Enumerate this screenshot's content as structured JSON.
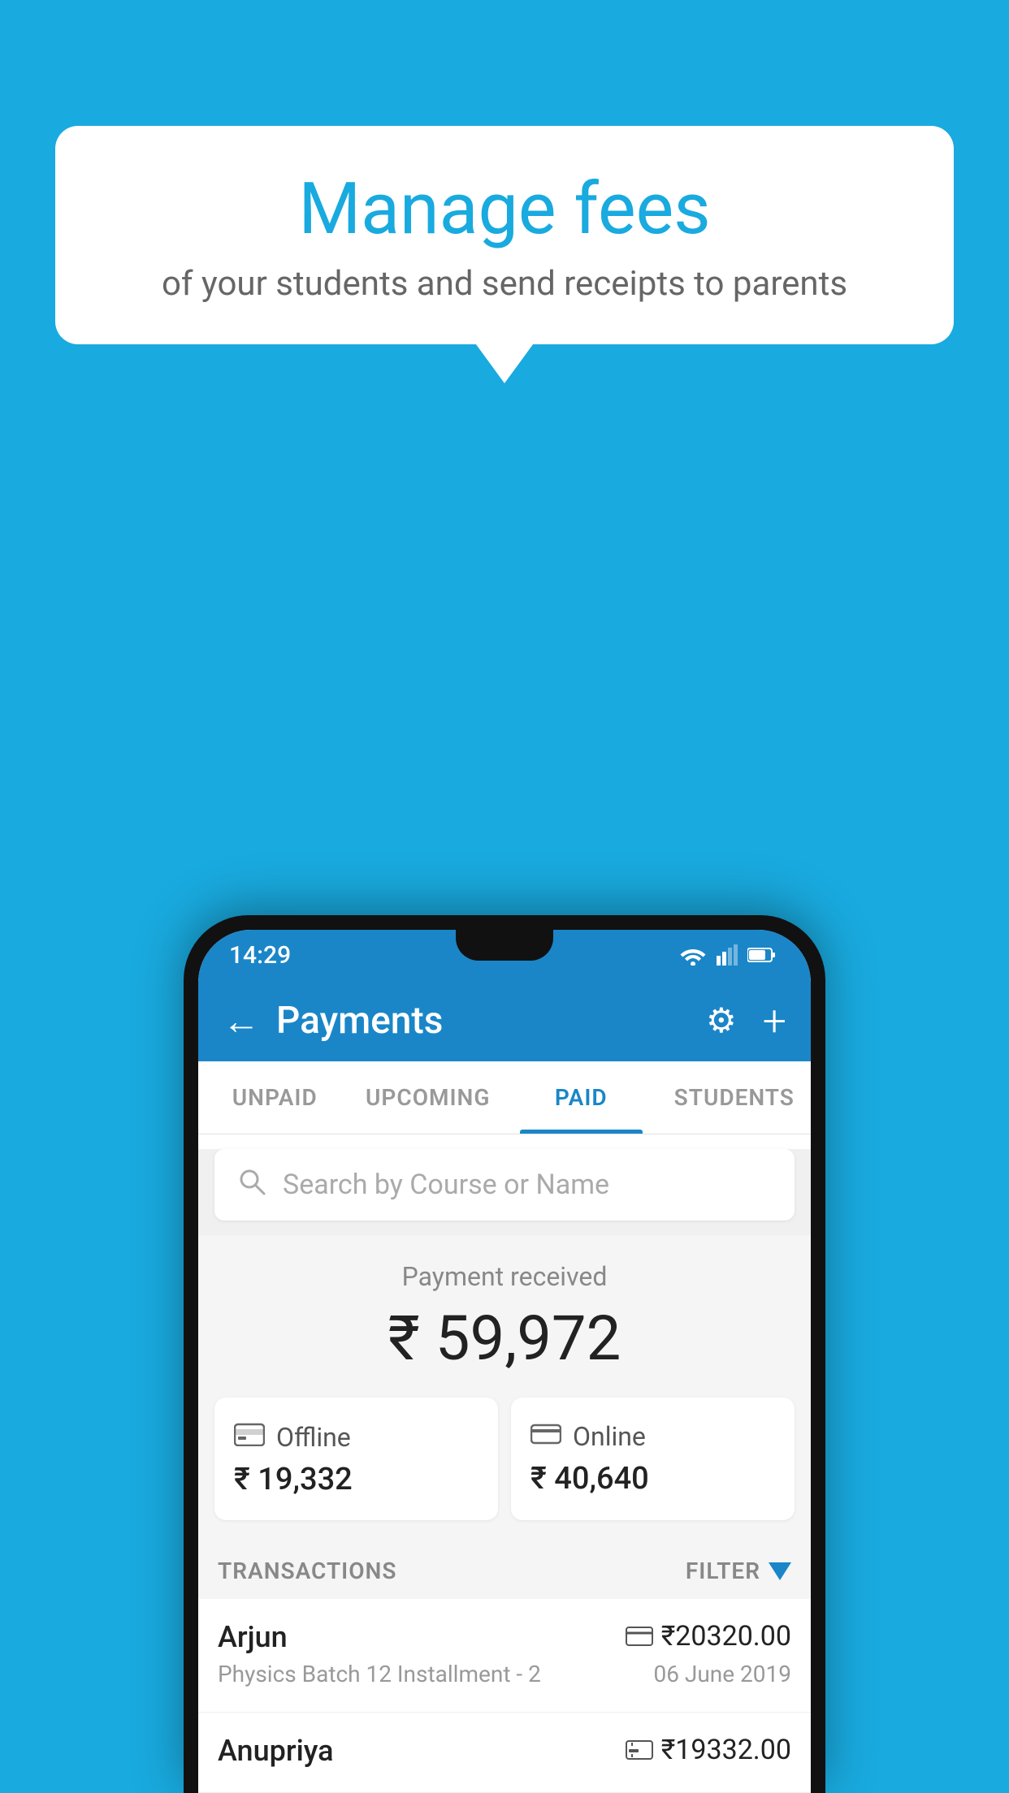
{
  "background": {
    "color": "#19AADF"
  },
  "bubble": {
    "title": "Manage fees",
    "subtitle": "of your students and send receipts to parents"
  },
  "status_bar": {
    "time": "14:29"
  },
  "header": {
    "title": "Payments",
    "back_label": "←",
    "settings_label": "⚙",
    "add_label": "+"
  },
  "tabs": [
    {
      "label": "UNPAID",
      "active": false
    },
    {
      "label": "UPCOMING",
      "active": false
    },
    {
      "label": "PAID",
      "active": true
    },
    {
      "label": "STUDENTS",
      "active": false
    }
  ],
  "search": {
    "placeholder": "Search by Course or Name"
  },
  "payment_received": {
    "label": "Payment received",
    "amount": "₹ 59,972"
  },
  "cards": [
    {
      "type": "Offline",
      "amount": "₹ 19,332",
      "icon": "💳"
    },
    {
      "type": "Online",
      "amount": "₹ 40,640",
      "icon": "💳"
    }
  ],
  "transactions_section": {
    "label": "TRANSACTIONS",
    "filter_label": "FILTER"
  },
  "transactions": [
    {
      "name": "Arjun",
      "course": "Physics Batch 12 Installment - 2",
      "amount": "₹20320.00",
      "date": "06 June 2019",
      "method": "online"
    },
    {
      "name": "Anupriya",
      "course": "",
      "amount": "₹19332.00",
      "date": "",
      "method": "offline"
    }
  ]
}
